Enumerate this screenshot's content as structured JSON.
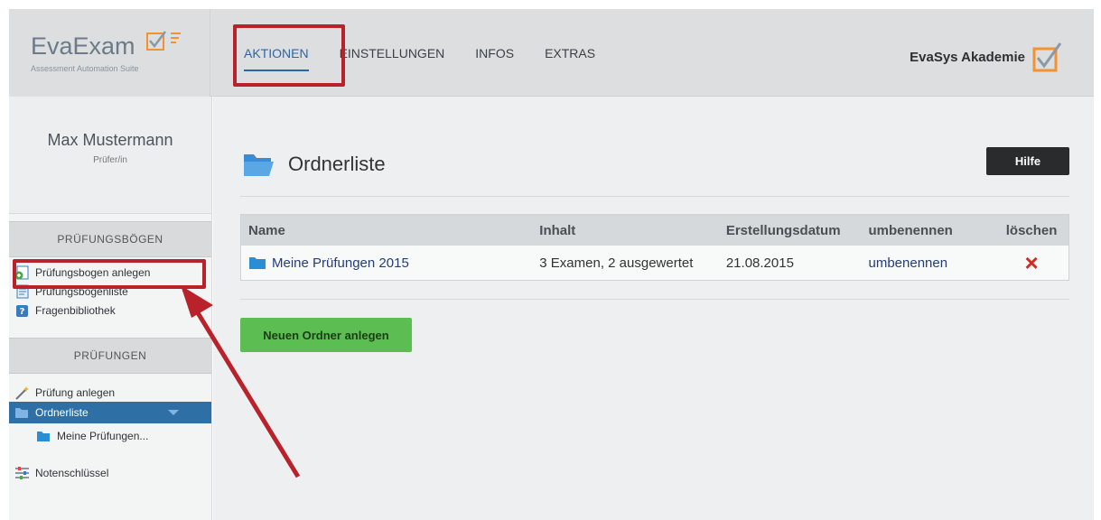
{
  "header": {
    "logo_main": "EvaExam",
    "logo_sub": "Assessment Automation Suite",
    "nav": [
      "AKTIONEN",
      "EINSTELLUNGEN",
      "INFOS",
      "EXTRAS"
    ],
    "brand": "EvaSys Akademie",
    "accent": "#f5912e"
  },
  "sidebar": {
    "user_name": "Max Mustermann",
    "user_role": "Prüfer/in",
    "section1": "PRÜFUNGSBÖGEN",
    "section1_items": [
      "Prüfungsbogen anlegen",
      "Prüfungsbogenliste",
      "Fragenbibliothek"
    ],
    "section2": "PRÜFUNGEN",
    "section2_items": [
      "Prüfung anlegen",
      "Ordnerliste",
      "Meine Prüfungen..."
    ],
    "extra_item": "Notenschlüssel"
  },
  "main": {
    "title": "Ordnerliste",
    "help_button": "Hilfe",
    "table": {
      "headers": [
        "Name",
        "Inhalt",
        "Erstellungsdatum",
        "umbenennen",
        "löschen"
      ],
      "rows": [
        {
          "name": "Meine Prüfungen 2015",
          "inhalt": "3 Examen, 2 ausgewertet",
          "date": "21.08.2015",
          "rename": "umbenennen",
          "delete": "×"
        }
      ]
    },
    "new_folder_button": "Neuen Ordner anlegen"
  }
}
